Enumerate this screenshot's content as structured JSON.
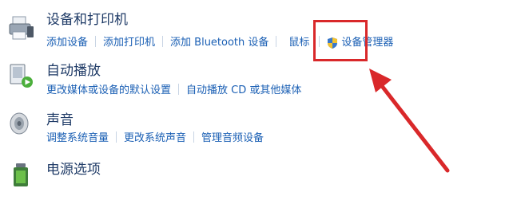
{
  "sections": [
    {
      "title": "设备和打印机",
      "icon": "printer-icon",
      "links": [
        "添加设备",
        "添加打印机",
        "添加 Bluetooth 设备",
        "鼠标",
        "设备管理器"
      ]
    },
    {
      "title": "自动播放",
      "icon": "autoplay-icon",
      "links": [
        "更改媒体或设备的默认设置",
        "自动播放 CD 或其他媒体"
      ]
    },
    {
      "title": "声音",
      "icon": "speaker-icon",
      "links": [
        "调整系统音量",
        "更改系统声音",
        "管理音频设备"
      ]
    },
    {
      "title": "电源选项",
      "icon": "power-icon",
      "links": []
    }
  ],
  "annotation": {
    "highlight_color": "#d9282a",
    "target": "鼠标"
  },
  "colors": {
    "link": "#1a5fb4",
    "title": "#1e3a66"
  }
}
